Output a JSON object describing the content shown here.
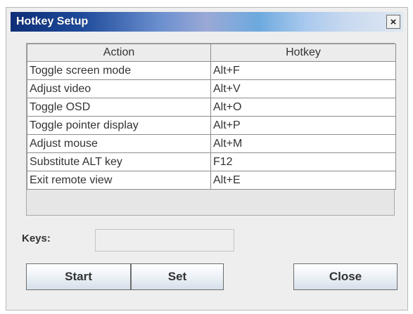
{
  "window": {
    "title": "Hotkey Setup",
    "close_glyph": "×",
    "title_bar_color": "#0e2e77"
  },
  "table": {
    "columns": [
      "Action",
      "Hotkey"
    ],
    "rows": [
      {
        "action": "Toggle screen mode",
        "hotkey": "Alt+F"
      },
      {
        "action": "Adjust video",
        "hotkey": "Alt+V"
      },
      {
        "action": "Toggle OSD",
        "hotkey": "Alt+O"
      },
      {
        "action": "Toggle pointer display",
        "hotkey": "Alt+P"
      },
      {
        "action": "Adjust mouse",
        "hotkey": "Alt+M"
      },
      {
        "action": "Substitute ALT key",
        "hotkey": "F12"
      },
      {
        "action": "Exit remote view",
        "hotkey": "Alt+E"
      }
    ]
  },
  "keys": {
    "label": "Keys:",
    "value": ""
  },
  "buttons": {
    "start": "Start",
    "set": "Set",
    "close": "Close"
  }
}
